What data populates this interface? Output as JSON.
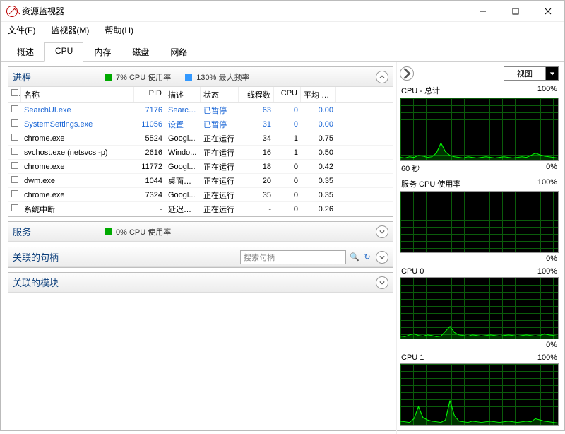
{
  "window": {
    "title": "资源监视器"
  },
  "menu": {
    "file": "文件(F)",
    "monitor": "监视器(M)",
    "help": "帮助(H)"
  },
  "tabs": {
    "overview": "概述",
    "cpu": "CPU",
    "memory": "内存",
    "disk": "磁盘",
    "network": "网络"
  },
  "panels": {
    "processes": {
      "title": "进程",
      "cpu_usage_label": "7% CPU 使用率",
      "max_freq_label": "130% 最大频率",
      "columns": {
        "name": "名称",
        "pid": "PID",
        "desc": "描述",
        "status": "状态",
        "threads": "线程数",
        "cpu": "CPU",
        "avg": "平均 C..."
      },
      "rows": [
        {
          "suspended": true,
          "name": "SearchUI.exe",
          "pid": "7176",
          "desc": "Search...",
          "status": "已暂停",
          "threads": "63",
          "cpu": "0",
          "avg": "0.00"
        },
        {
          "suspended": true,
          "name": "SystemSettings.exe",
          "pid": "11056",
          "desc": "设置",
          "status": "已暂停",
          "threads": "31",
          "cpu": "0",
          "avg": "0.00"
        },
        {
          "suspended": false,
          "name": "chrome.exe",
          "pid": "5524",
          "desc": "Googl...",
          "status": "正在运行",
          "threads": "34",
          "cpu": "1",
          "avg": "0.75"
        },
        {
          "suspended": false,
          "name": "svchost.exe (netsvcs -p)",
          "pid": "2616",
          "desc": "Windo...",
          "status": "正在运行",
          "threads": "16",
          "cpu": "1",
          "avg": "0.50"
        },
        {
          "suspended": false,
          "name": "chrome.exe",
          "pid": "11772",
          "desc": "Googl...",
          "status": "正在运行",
          "threads": "18",
          "cpu": "0",
          "avg": "0.42"
        },
        {
          "suspended": false,
          "name": "dwm.exe",
          "pid": "1044",
          "desc": "桌面窗...",
          "status": "正在运行",
          "threads": "20",
          "cpu": "0",
          "avg": "0.35"
        },
        {
          "suspended": false,
          "name": "chrome.exe",
          "pid": "7324",
          "desc": "Googl...",
          "status": "正在运行",
          "threads": "35",
          "cpu": "0",
          "avg": "0.35"
        },
        {
          "suspended": false,
          "name": "系统中断",
          "pid": "-",
          "desc": "延迟过...",
          "status": "正在运行",
          "threads": "-",
          "cpu": "0",
          "avg": "0.26"
        }
      ]
    },
    "services": {
      "title": "服务",
      "cpu_usage_label": "0% CPU 使用率"
    },
    "handles": {
      "title": "关联的句柄",
      "search_placeholder": "搜索句柄"
    },
    "modules": {
      "title": "关联的模块"
    }
  },
  "rightpane": {
    "view_label": "视图",
    "charts": {
      "total": {
        "title": "CPU - 总计",
        "max": "100%",
        "xleft": "60 秒",
        "xright": "0%"
      },
      "service": {
        "title": "服务 CPU 使用率",
        "max": "100%",
        "xright_only": "0%"
      },
      "cpu0": {
        "title": "CPU 0",
        "max": "100%",
        "xright_only": "0%"
      },
      "cpu1": {
        "title": "CPU 1",
        "max": "100%"
      }
    }
  },
  "chart_data": [
    {
      "type": "line",
      "name": "cpu_total",
      "ylim": [
        0,
        100
      ],
      "xrange_label": "60 秒",
      "series": [
        {
          "name": "usage",
          "values": [
            5,
            4,
            6,
            5,
            8,
            7,
            5,
            6,
            12,
            28,
            14,
            8,
            6,
            5,
            4,
            6,
            5,
            4,
            5,
            6,
            5,
            4,
            5,
            6,
            5,
            4,
            5,
            6,
            5,
            8,
            12,
            9,
            7,
            6,
            5,
            4
          ]
        }
      ]
    },
    {
      "type": "line",
      "name": "service_cpu",
      "ylim": [
        0,
        100
      ],
      "series": [
        {
          "name": "usage",
          "values": [
            0,
            0,
            0,
            0,
            0,
            0,
            0,
            0,
            0,
            0,
            0,
            0,
            0,
            0,
            0,
            0,
            0,
            0,
            0,
            0,
            0,
            0,
            0,
            0,
            0,
            0,
            0,
            0,
            0,
            0,
            0,
            0,
            0,
            0,
            0,
            0
          ]
        }
      ]
    },
    {
      "type": "line",
      "name": "cpu0",
      "ylim": [
        0,
        100
      ],
      "series": [
        {
          "name": "usage",
          "values": [
            4,
            3,
            6,
            8,
            5,
            4,
            6,
            5,
            3,
            4,
            12,
            20,
            10,
            6,
            5,
            4,
            6,
            5,
            4,
            5,
            6,
            5,
            4,
            5,
            6,
            5,
            4,
            5,
            6,
            5,
            4,
            5,
            8,
            6,
            5,
            4
          ]
        }
      ]
    },
    {
      "type": "line",
      "name": "cpu1",
      "ylim": [
        0,
        100
      ],
      "series": [
        {
          "name": "usage",
          "values": [
            6,
            5,
            4,
            10,
            30,
            12,
            8,
            6,
            5,
            4,
            8,
            40,
            15,
            6,
            5,
            4,
            6,
            5,
            4,
            5,
            6,
            5,
            4,
            5,
            6,
            5,
            4,
            5,
            6,
            5,
            10,
            8,
            6,
            5,
            4,
            3
          ]
        }
      ]
    }
  ]
}
